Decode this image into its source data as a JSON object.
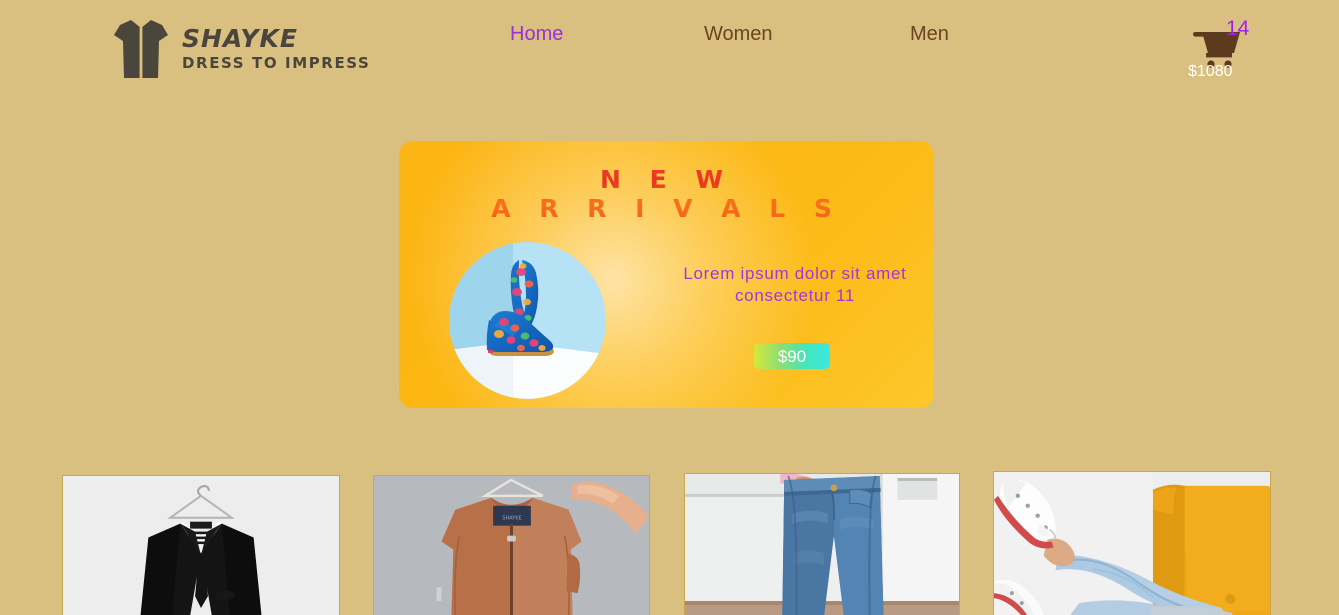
{
  "page": {
    "background_color": "#d9bf80"
  },
  "header": {
    "logo": {
      "icon": "shirt-icon",
      "name": "SHAYKE",
      "tagline": "DRESS TO IMPRESS",
      "color": "#4a463c"
    },
    "nav": {
      "items": [
        {
          "label": "Home",
          "active": true,
          "color": "#9b30d9"
        },
        {
          "label": "Women",
          "active": false,
          "color": "#6b4423"
        },
        {
          "label": "Men",
          "active": false,
          "color": "#6b4423"
        }
      ]
    },
    "cart": {
      "icon": "shopping-cart-icon",
      "count": "14",
      "count_color": "#a020f0",
      "total": "$1080",
      "total_color": "#ffffff",
      "icon_color": "#5c3a1e"
    }
  },
  "banner": {
    "title_line1": "N E W",
    "title_line2": "A R R I V A L S",
    "title_color": "#e8361f",
    "description": "Lorem ipsum dolor sit amet consectetur 11",
    "description_color": "#a236d6",
    "price": "$90",
    "price_color": "#ffffff",
    "background_color": "#fcb515",
    "image_alt": "blue-floral-high-heels-photo"
  },
  "products": [
    {
      "alt": "black-suit-on-hanger-photo"
    },
    {
      "alt": "rust-bomber-jacket-photo"
    },
    {
      "alt": "blue-jeans-worn-photo"
    },
    {
      "alt": "light-jeans-white-sneakers-yellow-chair-photo"
    }
  ]
}
